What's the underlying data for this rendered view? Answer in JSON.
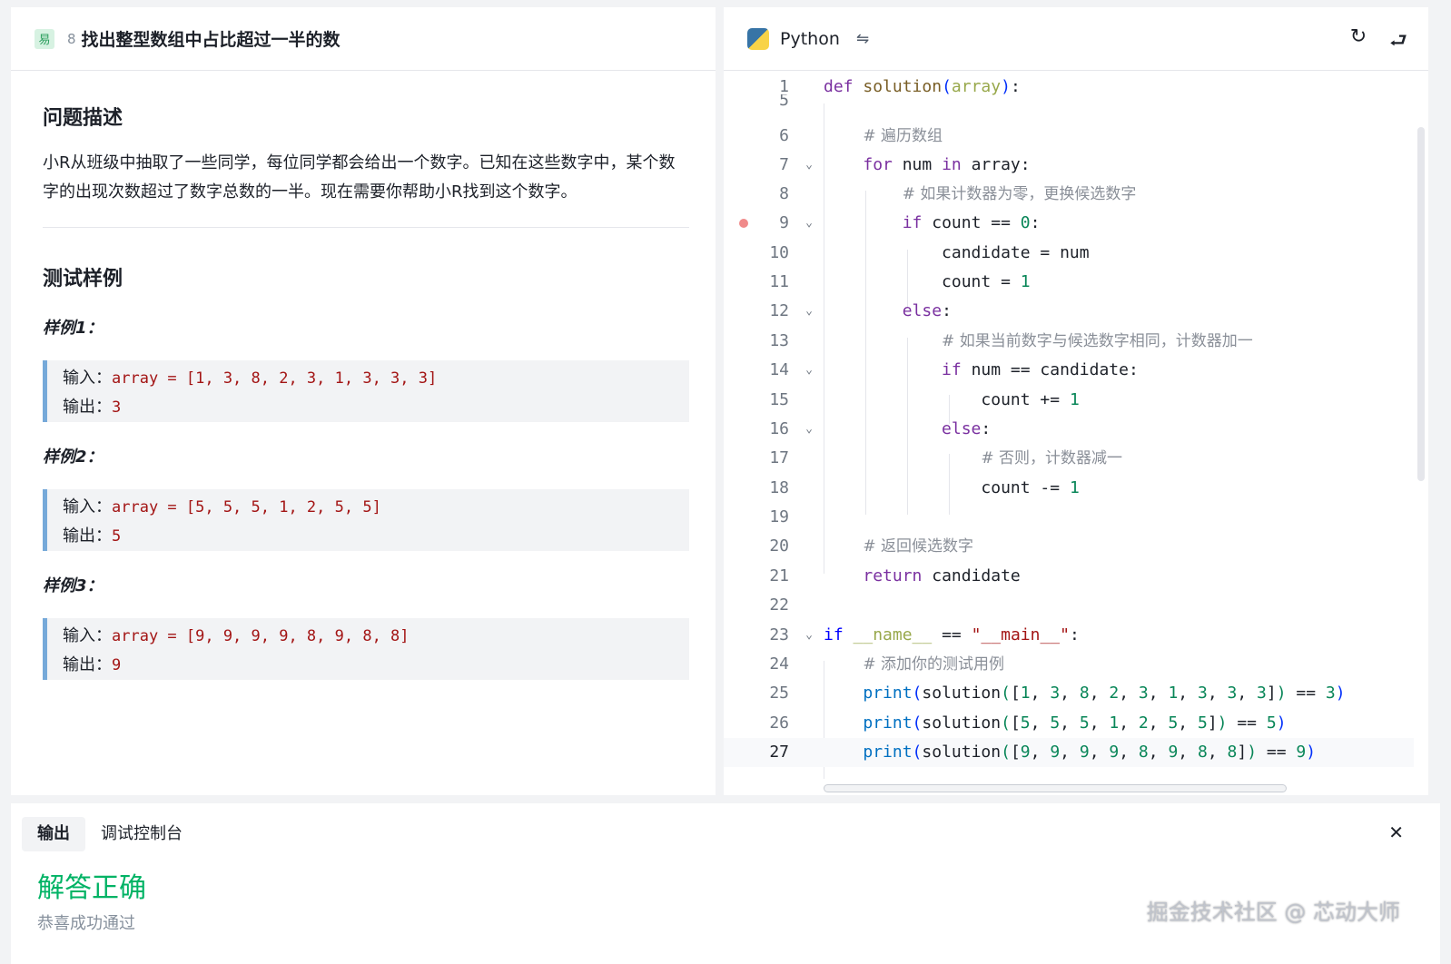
{
  "problem": {
    "difficulty": "易",
    "number": "8",
    "title": "找出整型数组中占比超过一半的数",
    "desc_heading": "问题描述",
    "description": "小R从班级中抽取了一些同学，每位同学都会给出一个数字。已知在这些数字中，某个数字的出现次数超过了数字总数的一半。现在需要你帮助小R找到这个数字。",
    "tests_heading": "测试样例",
    "examples": [
      {
        "title": "样例1：",
        "input_label": "输入：",
        "input": "array = [1, 3, 8, 2, 3, 1, 3, 3, 3]",
        "output_label": "输出：",
        "output": "3"
      },
      {
        "title": "样例2：",
        "input_label": "输入：",
        "input": "array = [5, 5, 5, 1, 2, 5, 5]",
        "output_label": "输出：",
        "output": "5"
      },
      {
        "title": "样例3：",
        "input_label": "输入：",
        "input": "array = [9, 9, 9, 9, 8, 9, 8, 8]",
        "output_label": "输出：",
        "output": "9"
      }
    ]
  },
  "editor": {
    "language": "Python",
    "icons": {
      "swap": "swap-icon",
      "reset": "refresh-icon",
      "wrap": "wrap-icon"
    },
    "line_numbers": [
      "1",
      "5",
      "6",
      "7",
      "8",
      "9",
      "10",
      "11",
      "12",
      "13",
      "14",
      "15",
      "16",
      "17",
      "18",
      "19",
      "20",
      "21",
      "22",
      "23",
      "24",
      "25",
      "26",
      "27"
    ],
    "active_line": "27"
  },
  "output": {
    "tabs": [
      "输出",
      "调试控制台"
    ],
    "result": "解答正确",
    "result_sub": "恭喜成功通过",
    "watermark": "掘金技术社区 @ 芯动大师"
  },
  "colors": {
    "accent_green": "#00b365",
    "example_border": "#76a9d9",
    "breakpoint": "#f08a8a"
  }
}
